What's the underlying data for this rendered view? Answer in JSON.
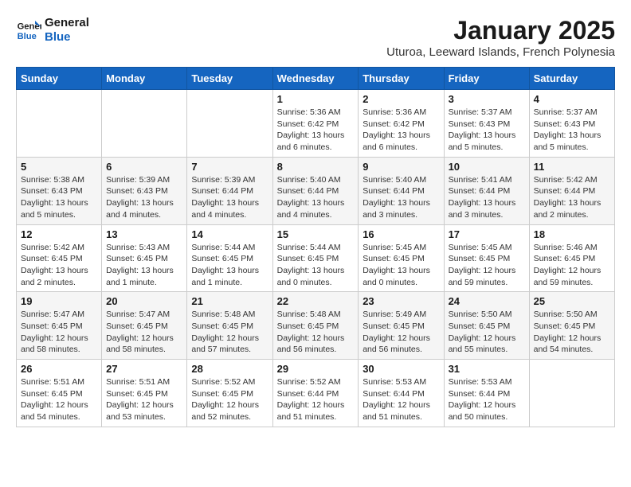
{
  "header": {
    "logo_line1": "General",
    "logo_line2": "Blue",
    "month_title": "January 2025",
    "location": "Uturoa, Leeward Islands, French Polynesia"
  },
  "weekdays": [
    "Sunday",
    "Monday",
    "Tuesday",
    "Wednesday",
    "Thursday",
    "Friday",
    "Saturday"
  ],
  "weeks": [
    [
      null,
      null,
      null,
      {
        "day": 1,
        "sunrise": "5:36 AM",
        "sunset": "6:42 PM",
        "daylight": "13 hours and 6 minutes."
      },
      {
        "day": 2,
        "sunrise": "5:36 AM",
        "sunset": "6:42 PM",
        "daylight": "13 hours and 6 minutes."
      },
      {
        "day": 3,
        "sunrise": "5:37 AM",
        "sunset": "6:43 PM",
        "daylight": "13 hours and 5 minutes."
      },
      {
        "day": 4,
        "sunrise": "5:37 AM",
        "sunset": "6:43 PM",
        "daylight": "13 hours and 5 minutes."
      }
    ],
    [
      {
        "day": 5,
        "sunrise": "5:38 AM",
        "sunset": "6:43 PM",
        "daylight": "13 hours and 5 minutes."
      },
      {
        "day": 6,
        "sunrise": "5:39 AM",
        "sunset": "6:43 PM",
        "daylight": "13 hours and 4 minutes."
      },
      {
        "day": 7,
        "sunrise": "5:39 AM",
        "sunset": "6:44 PM",
        "daylight": "13 hours and 4 minutes."
      },
      {
        "day": 8,
        "sunrise": "5:40 AM",
        "sunset": "6:44 PM",
        "daylight": "13 hours and 4 minutes."
      },
      {
        "day": 9,
        "sunrise": "5:40 AM",
        "sunset": "6:44 PM",
        "daylight": "13 hours and 3 minutes."
      },
      {
        "day": 10,
        "sunrise": "5:41 AM",
        "sunset": "6:44 PM",
        "daylight": "13 hours and 3 minutes."
      },
      {
        "day": 11,
        "sunrise": "5:42 AM",
        "sunset": "6:44 PM",
        "daylight": "13 hours and 2 minutes."
      }
    ],
    [
      {
        "day": 12,
        "sunrise": "5:42 AM",
        "sunset": "6:45 PM",
        "daylight": "13 hours and 2 minutes."
      },
      {
        "day": 13,
        "sunrise": "5:43 AM",
        "sunset": "6:45 PM",
        "daylight": "13 hours and 1 minute."
      },
      {
        "day": 14,
        "sunrise": "5:44 AM",
        "sunset": "6:45 PM",
        "daylight": "13 hours and 1 minute."
      },
      {
        "day": 15,
        "sunrise": "5:44 AM",
        "sunset": "6:45 PM",
        "daylight": "13 hours and 0 minutes."
      },
      {
        "day": 16,
        "sunrise": "5:45 AM",
        "sunset": "6:45 PM",
        "daylight": "13 hours and 0 minutes."
      },
      {
        "day": 17,
        "sunrise": "5:45 AM",
        "sunset": "6:45 PM",
        "daylight": "12 hours and 59 minutes."
      },
      {
        "day": 18,
        "sunrise": "5:46 AM",
        "sunset": "6:45 PM",
        "daylight": "12 hours and 59 minutes."
      }
    ],
    [
      {
        "day": 19,
        "sunrise": "5:47 AM",
        "sunset": "6:45 PM",
        "daylight": "12 hours and 58 minutes."
      },
      {
        "day": 20,
        "sunrise": "5:47 AM",
        "sunset": "6:45 PM",
        "daylight": "12 hours and 58 minutes."
      },
      {
        "day": 21,
        "sunrise": "5:48 AM",
        "sunset": "6:45 PM",
        "daylight": "12 hours and 57 minutes."
      },
      {
        "day": 22,
        "sunrise": "5:48 AM",
        "sunset": "6:45 PM",
        "daylight": "12 hours and 56 minutes."
      },
      {
        "day": 23,
        "sunrise": "5:49 AM",
        "sunset": "6:45 PM",
        "daylight": "12 hours and 56 minutes."
      },
      {
        "day": 24,
        "sunrise": "5:50 AM",
        "sunset": "6:45 PM",
        "daylight": "12 hours and 55 minutes."
      },
      {
        "day": 25,
        "sunrise": "5:50 AM",
        "sunset": "6:45 PM",
        "daylight": "12 hours and 54 minutes."
      }
    ],
    [
      {
        "day": 26,
        "sunrise": "5:51 AM",
        "sunset": "6:45 PM",
        "daylight": "12 hours and 54 minutes."
      },
      {
        "day": 27,
        "sunrise": "5:51 AM",
        "sunset": "6:45 PM",
        "daylight": "12 hours and 53 minutes."
      },
      {
        "day": 28,
        "sunrise": "5:52 AM",
        "sunset": "6:45 PM",
        "daylight": "12 hours and 52 minutes."
      },
      {
        "day": 29,
        "sunrise": "5:52 AM",
        "sunset": "6:44 PM",
        "daylight": "12 hours and 51 minutes."
      },
      {
        "day": 30,
        "sunrise": "5:53 AM",
        "sunset": "6:44 PM",
        "daylight": "12 hours and 51 minutes."
      },
      {
        "day": 31,
        "sunrise": "5:53 AM",
        "sunset": "6:44 PM",
        "daylight": "12 hours and 50 minutes."
      },
      null
    ]
  ]
}
